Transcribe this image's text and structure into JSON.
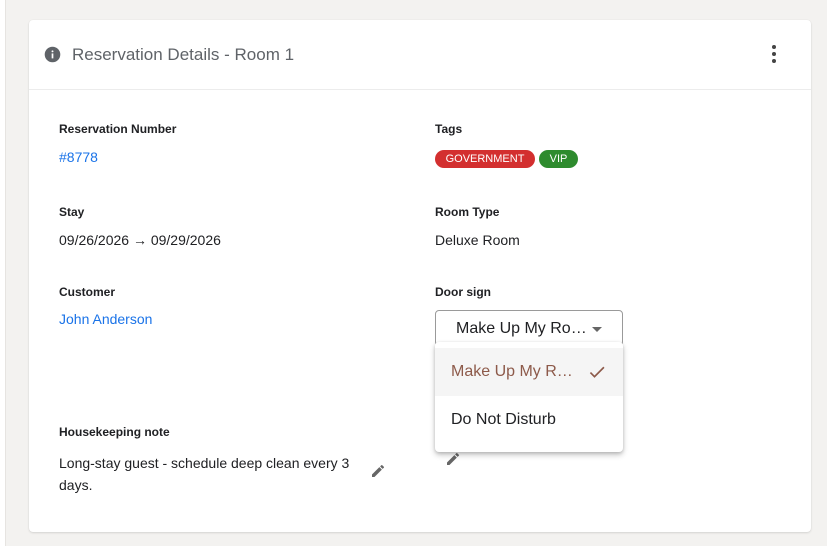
{
  "card": {
    "title": "Reservation Details - Room 1",
    "info_icon": "info-circle-icon",
    "menu_icon": "more-vert-icon"
  },
  "fields": {
    "reservation_number": {
      "label": "Reservation Number",
      "value": "#8778"
    },
    "tags": {
      "label": "Tags",
      "items": [
        {
          "label": "GOVERNMENT",
          "color": "#d32f2f"
        },
        {
          "label": "VIP",
          "color": "#2e8b2e"
        }
      ]
    },
    "stay": {
      "label": "Stay",
      "value": "09/26/2026 → 09/29/2026"
    },
    "room_type": {
      "label": "Room Type",
      "value": "Deluxe Room"
    },
    "customer": {
      "label": "Customer",
      "value": "John Anderson"
    },
    "door_sign": {
      "label": "Door sign",
      "selected": "Make Up My Ro…",
      "options": [
        {
          "label": "Make Up My R…",
          "selected": true
        },
        {
          "label": "Do Not Disturb",
          "selected": false
        }
      ]
    },
    "housekeeping_note": {
      "label": "Housekeeping note",
      "value": "Long-stay guest - schedule deep clean every 3 days."
    }
  },
  "colors": {
    "link": "#1a73e8",
    "selected_option": "#8d5a4a"
  }
}
